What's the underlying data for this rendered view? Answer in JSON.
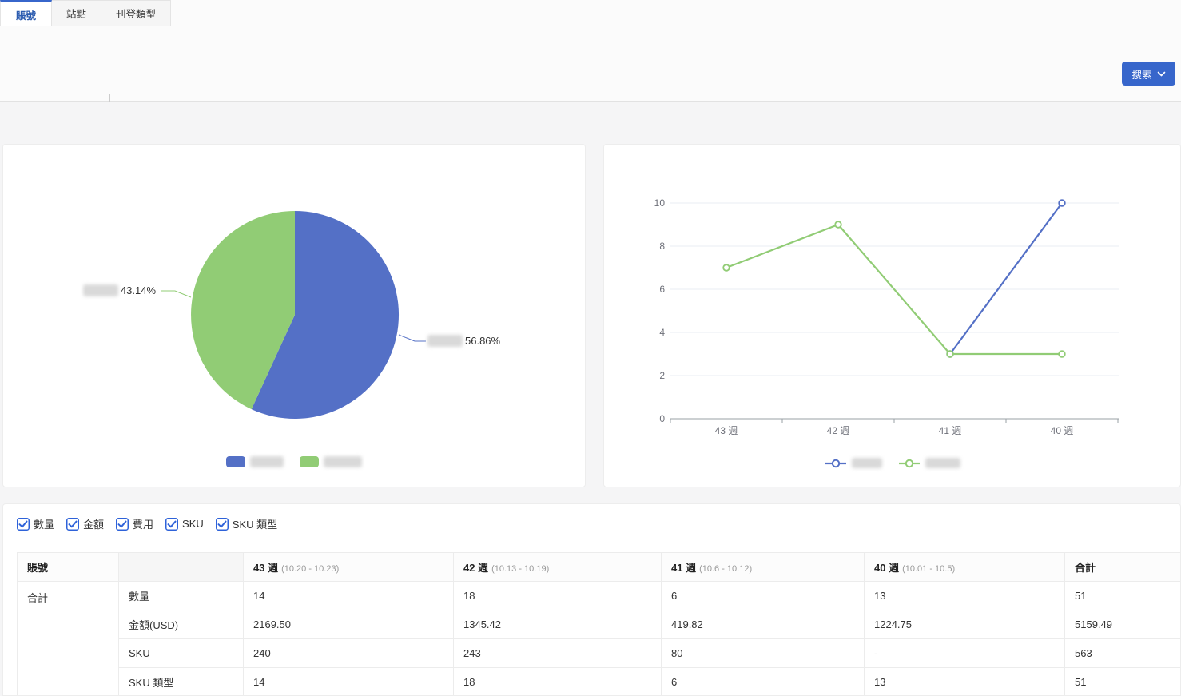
{
  "tabs": [
    {
      "label": "賬號",
      "active": true
    },
    {
      "label": "站點",
      "active": false
    },
    {
      "label": "刊登類型",
      "active": false
    }
  ],
  "toolbar": {
    "search_label": "搜索"
  },
  "colors": {
    "accent_blue": "#3766cb",
    "series_blue": "#5470c6",
    "series_green": "#91cc75"
  },
  "chart_data": [
    {
      "type": "pie",
      "title": "",
      "start_angle_deg": -90,
      "slices": [
        {
          "label_redacted": true,
          "value_pct": 56.86,
          "percent_label": "56.86%",
          "color": "#5470c6"
        },
        {
          "label_redacted": true,
          "value_pct": 43.14,
          "percent_label": "43.14%",
          "color": "#91cc75"
        }
      ],
      "legend": [
        {
          "label_redacted": true,
          "color": "#5470c6"
        },
        {
          "label_redacted": true,
          "color": "#91cc75"
        }
      ],
      "legend_position": "bottom"
    },
    {
      "type": "line",
      "categories": [
        "43 週",
        "42 週",
        "41 週",
        "40 週"
      ],
      "series": [
        {
          "label_redacted": true,
          "color": "#5470c6",
          "values": [
            null,
            null,
            3,
            10
          ]
        },
        {
          "label_redacted": true,
          "color": "#91cc75",
          "values": [
            7,
            9,
            3,
            3
          ]
        }
      ],
      "ylim": [
        0,
        10
      ],
      "yticks": [
        0,
        2,
        4,
        6,
        8,
        10
      ],
      "grid": true,
      "legend_position": "bottom"
    }
  ],
  "filters": [
    {
      "label": "數量",
      "checked": true
    },
    {
      "label": "金額",
      "checked": true
    },
    {
      "label": "費用",
      "checked": true
    },
    {
      "label": "SKU",
      "checked": true
    },
    {
      "label": "SKU 類型",
      "checked": true
    }
  ],
  "table": {
    "col1_header": "賬號",
    "week_headers": [
      {
        "week": "43 週",
        "range": "(10.20 - 10.23)"
      },
      {
        "week": "42 週",
        "range": "(10.13 - 10.19)"
      },
      {
        "week": "41 週",
        "range": "(10.6 - 10.12)"
      },
      {
        "week": "40 週",
        "range": "(10.01 - 10.5)"
      }
    ],
    "total_header": "合計",
    "row_group_label": "合計",
    "rows": [
      {
        "metric": "數量",
        "values": [
          "14",
          "18",
          "6",
          "13",
          "51"
        ]
      },
      {
        "metric": "金額(USD)",
        "values": [
          "2169.50",
          "1345.42",
          "419.82",
          "1224.75",
          "5159.49"
        ]
      },
      {
        "metric": "SKU",
        "values": [
          "240",
          "243",
          "80",
          "-",
          "563"
        ]
      },
      {
        "metric": "SKU 類型",
        "values": [
          "14",
          "18",
          "6",
          "13",
          "51"
        ]
      }
    ]
  }
}
